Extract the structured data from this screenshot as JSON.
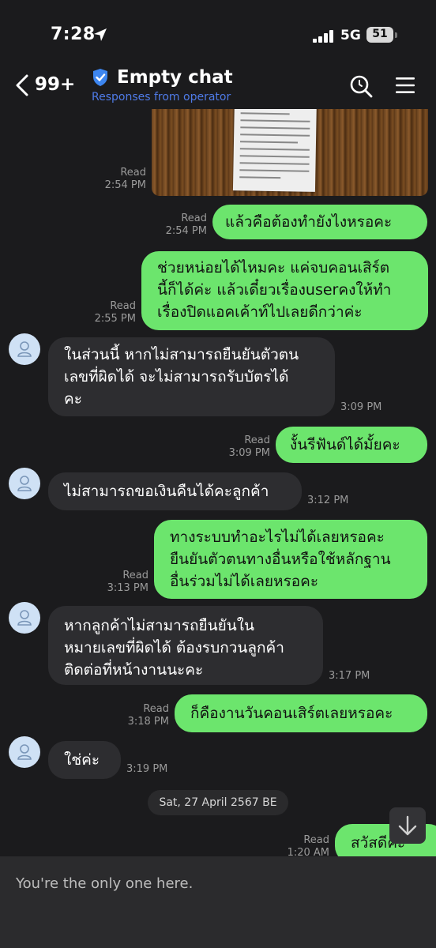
{
  "status_bar": {
    "time": "7:28",
    "network": "5G",
    "battery": "51"
  },
  "header": {
    "unread_count": "99+",
    "title": "Empty chat",
    "subtitle": "Responses from operator"
  },
  "messages": [
    {
      "dir": "out",
      "kind": "image",
      "read": "Read",
      "time": "2:54 PM"
    },
    {
      "dir": "out",
      "read": "Read",
      "time": "2:54 PM",
      "lines": [
        "แล้วคือต้องทำยังไงหรอคะ"
      ]
    },
    {
      "dir": "out",
      "read": "Read",
      "time": "2:55 PM",
      "lines": [
        "ช่วยหน่อยได้ไหมคะ แค่จบคอนเสิร์ต",
        "นี้ก็ได้ค่ะ แล้วเดี๋ยวเรื่องuserคงให้ทำ",
        "เรื่องปิดแอคเค้าท์ไปเลยดีกว่าค่ะ"
      ]
    },
    {
      "dir": "in",
      "time": "3:09 PM",
      "lines": [
        "ในส่วนนี้ หากไม่สามารถยืนยันตัวตน",
        "เลขที่ผิดได้ จะไม่สามารถรับบัตรได้",
        "คะ"
      ]
    },
    {
      "dir": "out",
      "read": "Read",
      "time": "3:09 PM",
      "lines": [
        "งั้นรีฟันด์ได้มั้ยคะ"
      ]
    },
    {
      "dir": "in",
      "time": "3:12 PM",
      "lines": [
        "ไม่สามารถขอเงินคืนได้คะลูกค้า"
      ]
    },
    {
      "dir": "out",
      "read": "Read",
      "time": "3:13 PM",
      "lines": [
        "ทางระบบทำอะไรไม่ได้เลยหรอคะ",
        "ยืนยันตัวตนทางอื่นหรือใช้หลักฐาน",
        "อื่นร่วมไม่ได้เลยหรอคะ"
      ]
    },
    {
      "dir": "in",
      "time": "3:17 PM",
      "lines": [
        "หากลูกค้าไม่สามารถยืนยันใน",
        "หมายเลขที่ผิดได้ ต้องรบกวนลูกค้า",
        "ติดต่อที่หน้างานนะคะ"
      ]
    },
    {
      "dir": "out",
      "read": "Read",
      "time": "3:18 PM",
      "lines": [
        "ก็คืองานวันคอนเสิร์ตเลยหรอคะ"
      ]
    },
    {
      "dir": "in",
      "time": "3:19 PM",
      "lines": [
        "ใช่ค่ะ"
      ]
    },
    {
      "dir": "out",
      "read": "Read",
      "time": "1:20 AM",
      "lines": [
        "สวัสดีค่ะ"
      ]
    }
  ],
  "date_separator": "Sat, 27 April 2567 BE",
  "footer": {
    "notice": "You're the only one here."
  }
}
